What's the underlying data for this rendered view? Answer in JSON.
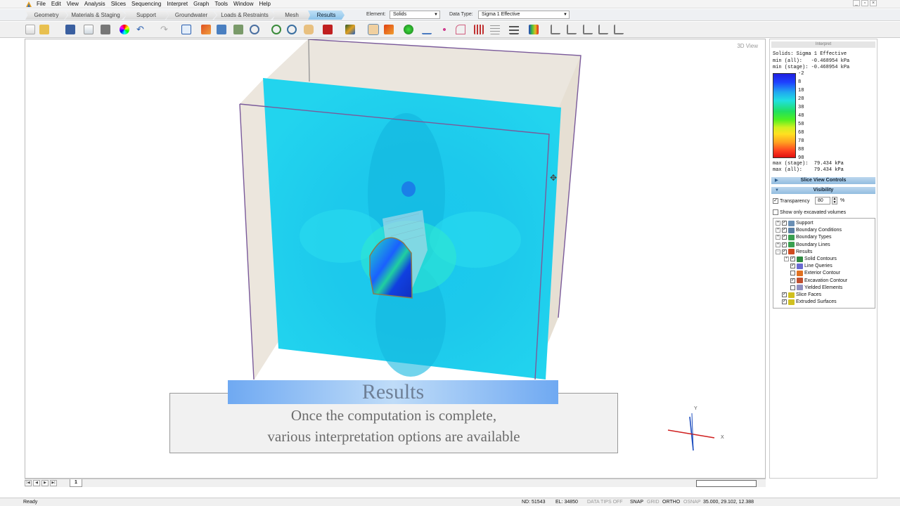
{
  "menubar": {
    "items": [
      "File",
      "Edit",
      "View",
      "Analysis",
      "Slices",
      "Sequencing",
      "Interpret",
      "Graph",
      "Tools",
      "Window",
      "Help"
    ]
  },
  "workflow_tabs": {
    "items": [
      "Geometry",
      "Materials & Staging",
      "Support",
      "Groundwater",
      "Loads & Restraints",
      "Mesh",
      "Results"
    ],
    "active": "Results"
  },
  "element_select": {
    "label": "Element:",
    "value": "Solids"
  },
  "datatype_select": {
    "label": "Data Type:",
    "value": "Sigma 1 Effective"
  },
  "toolbar": {
    "icons": [
      "new-file-icon",
      "open-folder-icon",
      "save-icon",
      "print-preview-icon",
      "print-icon",
      "color-wheel-icon",
      "undo-icon",
      "redo-icon",
      "layout-icon",
      "tools-icon",
      "compute-icon",
      "calculator-icon",
      "zoom-icon",
      "zoom-in-icon",
      "zoom-out-icon",
      "pan-hand-icon",
      "box-view-icon",
      "contour-icon",
      "pointer-icon",
      "solid-icon",
      "sphere-icon",
      "line-query-icon",
      "points-icon",
      "curve-icon",
      "grid-icon",
      "grid2-icon",
      "align-icon",
      "color-map-icon",
      "ruler1-icon",
      "ruler2-icon",
      "ruler3-icon",
      "ruler4-icon",
      "ruler5-icon"
    ]
  },
  "viewport": {
    "label": "3D View",
    "axes": {
      "x": "X",
      "y": "Y"
    }
  },
  "overlay": {
    "title": "Results",
    "line1": "Once the computation is complete,",
    "line2": "various interpretation options are available"
  },
  "legend": {
    "header": "Interpret",
    "title": "Solids: Sigma 1 Effective",
    "min_all": "min (all):   -0.468954 kPa",
    "min_stage": "min (stage): -0.468954 kPa",
    "ticks": [
      "-2",
      "8",
      "18",
      "28",
      "38",
      "48",
      "58",
      "68",
      "78",
      "88",
      "98"
    ],
    "max_stage": "max (stage):  79.434 kPa",
    "max_all": "max (all):    79.434 kPa",
    "colors": [
      "#2020e0",
      "#20a8f0",
      "#20e060",
      "#ffe020",
      "#e01010"
    ]
  },
  "slice_view_controls": {
    "label": "Slice View Controls"
  },
  "visibility": {
    "label": "Visibility",
    "transparency_label": "Transparency",
    "transparency_value": "80",
    "transparency_unit": "%",
    "transparency_checked": true,
    "excavated_label": "Show only excavated volumes",
    "excavated_checked": false
  },
  "tree": [
    {
      "label": "Support",
      "level": 0,
      "expander": "+",
      "checked": true,
      "icon": "support-icon",
      "color": "#6a8fb4"
    },
    {
      "label": "Boundary Conditions",
      "level": 0,
      "expander": "+",
      "checked": true,
      "icon": "boundary-conditions-icon",
      "color": "#5a7fa4"
    },
    {
      "label": "Boundary Types",
      "level": 0,
      "expander": "+",
      "checked": true,
      "icon": "boundary-types-icon",
      "color": "#3aa050"
    },
    {
      "label": "Boundary Lines",
      "level": 0,
      "expander": "+",
      "checked": true,
      "icon": "boundary-lines-icon",
      "color": "#3aa050"
    },
    {
      "label": "Results",
      "level": 0,
      "expander": "-",
      "checked": true,
      "icon": "results-icon",
      "color": "#d04a20"
    },
    {
      "label": "Solid Contours",
      "level": 1,
      "expander": "+",
      "checked": true,
      "icon": "solid-contours-icon",
      "color": "#2e8a40"
    },
    {
      "label": "Line Queries",
      "level": 1,
      "expander": "",
      "checked": true,
      "icon": "line-queries-icon",
      "color": "#6a6ad0"
    },
    {
      "label": "Exterior Contour",
      "level": 1,
      "expander": "",
      "checked": false,
      "icon": "exterior-contour-icon",
      "color": "#e07020"
    },
    {
      "label": "Excavation Contour",
      "level": 1,
      "expander": "",
      "checked": true,
      "icon": "excavation-contour-icon",
      "color": "#c05030"
    },
    {
      "label": "Yielded Elements",
      "level": 1,
      "expander": "",
      "checked": false,
      "icon": "yielded-elements-icon",
      "color": "#9090c0"
    },
    {
      "label": "Slice Faces",
      "level": 0,
      "expander": "",
      "checked": true,
      "icon": "slice-faces-icon",
      "color": "#d0c020"
    },
    {
      "label": "Extruded Surfaces",
      "level": 0,
      "expander": "",
      "checked": true,
      "icon": "extruded-surfaces-icon",
      "color": "#d0c020"
    }
  ],
  "sheet_tab": {
    "label": "1"
  },
  "status": {
    "ready": "Ready",
    "nd": "ND: 51543",
    "el": "EL: 34850",
    "data_tips": "DATA TIPS OFF",
    "snap": "SNAP",
    "grid": "GRID",
    "ortho": "ORTHO",
    "osnap": "OSNAP",
    "coords": "35.000, 29.102, 12.388"
  }
}
